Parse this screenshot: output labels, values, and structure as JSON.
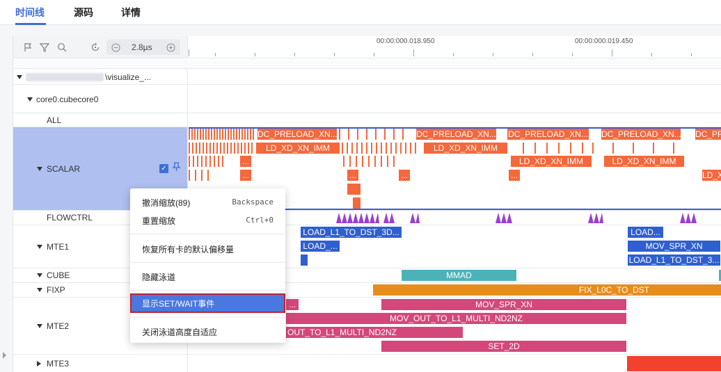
{
  "tabs": [
    {
      "label": "时间线",
      "active": true
    },
    {
      "label": "源码",
      "active": false
    },
    {
      "label": "详情",
      "active": false
    }
  ],
  "toolbar": {
    "zoom_value": "2.8µs",
    "icons": [
      "flag-icon",
      "filter-icon",
      "search-icon",
      "reset-icon",
      "zoom-out-icon",
      "zoom-in-icon"
    ]
  },
  "ruler": {
    "labels": [
      "00:00:000.018.950",
      "00:00:000.019.450"
    ]
  },
  "tree": {
    "root_path_suffix": "\\visualize_...",
    "core_label": "core0.cubecore0"
  },
  "rows": {
    "all": "ALL",
    "scalar": "SCALAR",
    "flowctrl": "FLOWCTRL",
    "mte1": "MTE1",
    "cube": "CUBE",
    "fixp": "FIXP",
    "mte2": "MTE2",
    "mte3": "MTE3"
  },
  "blocks": {
    "dc_preload": "DC_PRELOAD_XN...",
    "dc_preload_cut": "DC_PR",
    "ld_xd_xn_imm": "LD_XD_XN_IMM",
    "ld_xd_cut": "LD_X",
    "ellipsis": "...",
    "load_l1_to_dst_3d": "LOAD_L1_TO_DST_3D...",
    "load_l1_to_dst_3_short": "LOAD_L1_TO_DST_3...",
    "load_short": "LOAD_...",
    "load_short2": "LOAD...",
    "mov_spr_xn": "MOV_SPR_XN",
    "mmad": "MMAD",
    "fix_l0c_to_dst": "FIX_L0C_TO_DST",
    "mov_out_to_l1_multi_nd2nz": "MOV_OUT_TO_L1_MULTI_ND2NZ",
    "out_to_l1_multi_nd2nz": "OUT_TO_L1_MULTI_ND2NZ",
    "set_2d": "SET_2D",
    "mte2_ellipsis": "..."
  },
  "context_menu": {
    "items": [
      {
        "label": "撤消缩放(89)",
        "shortcut": "Backspace"
      },
      {
        "label": "重置缩放",
        "shortcut": "Ctrl+0"
      },
      {
        "label": "恢复所有卡的默认偏移量",
        "shortcut": ""
      },
      {
        "label": "隐藏泳道",
        "shortcut": ""
      },
      {
        "label": "显示SET/WAIT事件",
        "shortcut": "",
        "highlighted": true
      },
      {
        "label": "关闭泳道高度自适应",
        "shortcut": ""
      }
    ]
  },
  "colors": {
    "accent": "#3d6fd7",
    "scalar": "#f4683c",
    "flowctrl": "#9b3fd1",
    "mte1": "#2f5fd0",
    "cube": "#4bb3b8",
    "fixp": "#e88c1c",
    "mte2": "#d4477a",
    "mte3": "#f2412e",
    "selected_row": "#aebff0"
  }
}
